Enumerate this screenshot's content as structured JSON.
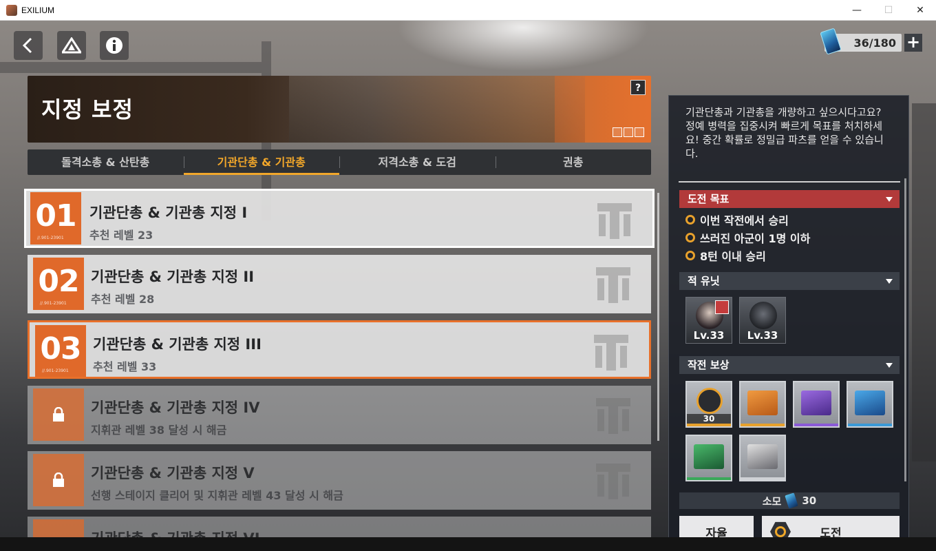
{
  "window": {
    "title": "EXILIUM",
    "minimize": "—",
    "maximize": "☐",
    "close": "✕"
  },
  "stamina": {
    "value": "36/180",
    "plus": "+"
  },
  "banner": {
    "title": "지정 보정",
    "help": "?"
  },
  "tabs": [
    {
      "label": "돌격소총 & 산탄총",
      "active": false
    },
    {
      "label": "기관단총 & 기관총",
      "active": true
    },
    {
      "label": "저격소총 & 도검",
      "active": false
    },
    {
      "label": "권총",
      "active": false
    }
  ],
  "stages": [
    {
      "num": "01",
      "name": "기관단총 & 기관총 지정 I",
      "sub": "추천 레벨 23",
      "locked": false
    },
    {
      "num": "02",
      "name": "기관단총 & 기관총 지정 II",
      "sub": "추천 레벨 28",
      "locked": false
    },
    {
      "num": "03",
      "name": "기관단총 & 기관총 지정 III",
      "sub": "추천 레벨 33",
      "locked": false
    },
    {
      "num": "",
      "name": "기관단총 & 기관총 지정 IV",
      "sub": "지휘관 레벨 38 달성 시 해금",
      "locked": true
    },
    {
      "num": "",
      "name": "기관단총 & 기관총 지정 V",
      "sub": "선행 스테이지 클리어 및 지휘관 레벨 43 달성 시 해금",
      "locked": true
    },
    {
      "num": "",
      "name": "기관단총 & 기관총 지정 VI",
      "sub": "",
      "locked": true
    }
  ],
  "panel": {
    "description": "기관단총과 기관총을 개량하고 싶으시다고요? 정예 병력을 집중시켜 빠르게 목표를 처치하세요! 중간 확률로 정밀급 파츠를 얻을 수 있습니다.",
    "objectives_header": "도전 목표",
    "objectives": [
      "이번 작전에서 승리",
      "쓰러진 아군이 1명 이하",
      "8턴 이내 승리"
    ],
    "enemies_header": "적 유닛",
    "enemies": [
      {
        "level": "Lv.33"
      },
      {
        "level": "Lv.33"
      }
    ],
    "rewards_header": "작전 보상",
    "rewards": [
      {
        "icon": "medal-icon",
        "qty": "30",
        "color": "#e8a12c"
      },
      {
        "icon": "orange-crate-icon",
        "qty": "",
        "color": "#e8a12c"
      },
      {
        "icon": "purple-crate-icon",
        "qty": "",
        "color": "#8a5ad8"
      },
      {
        "icon": "blue-crate-icon",
        "qty": "",
        "color": "#3a9ad8"
      },
      {
        "icon": "green-crate-icon",
        "qty": "",
        "color": "#3aa85a"
      },
      {
        "icon": "supply-box-icon",
        "qty": "",
        "color": "#cfd2d6"
      }
    ],
    "cost_label": "소모",
    "cost_value": "30",
    "auto_button": "자율",
    "start_button": "도전"
  },
  "colors": {
    "accent_orange": "#e0692a",
    "tab_active": "#f2a72a",
    "objective_header": "#b23a3a"
  }
}
